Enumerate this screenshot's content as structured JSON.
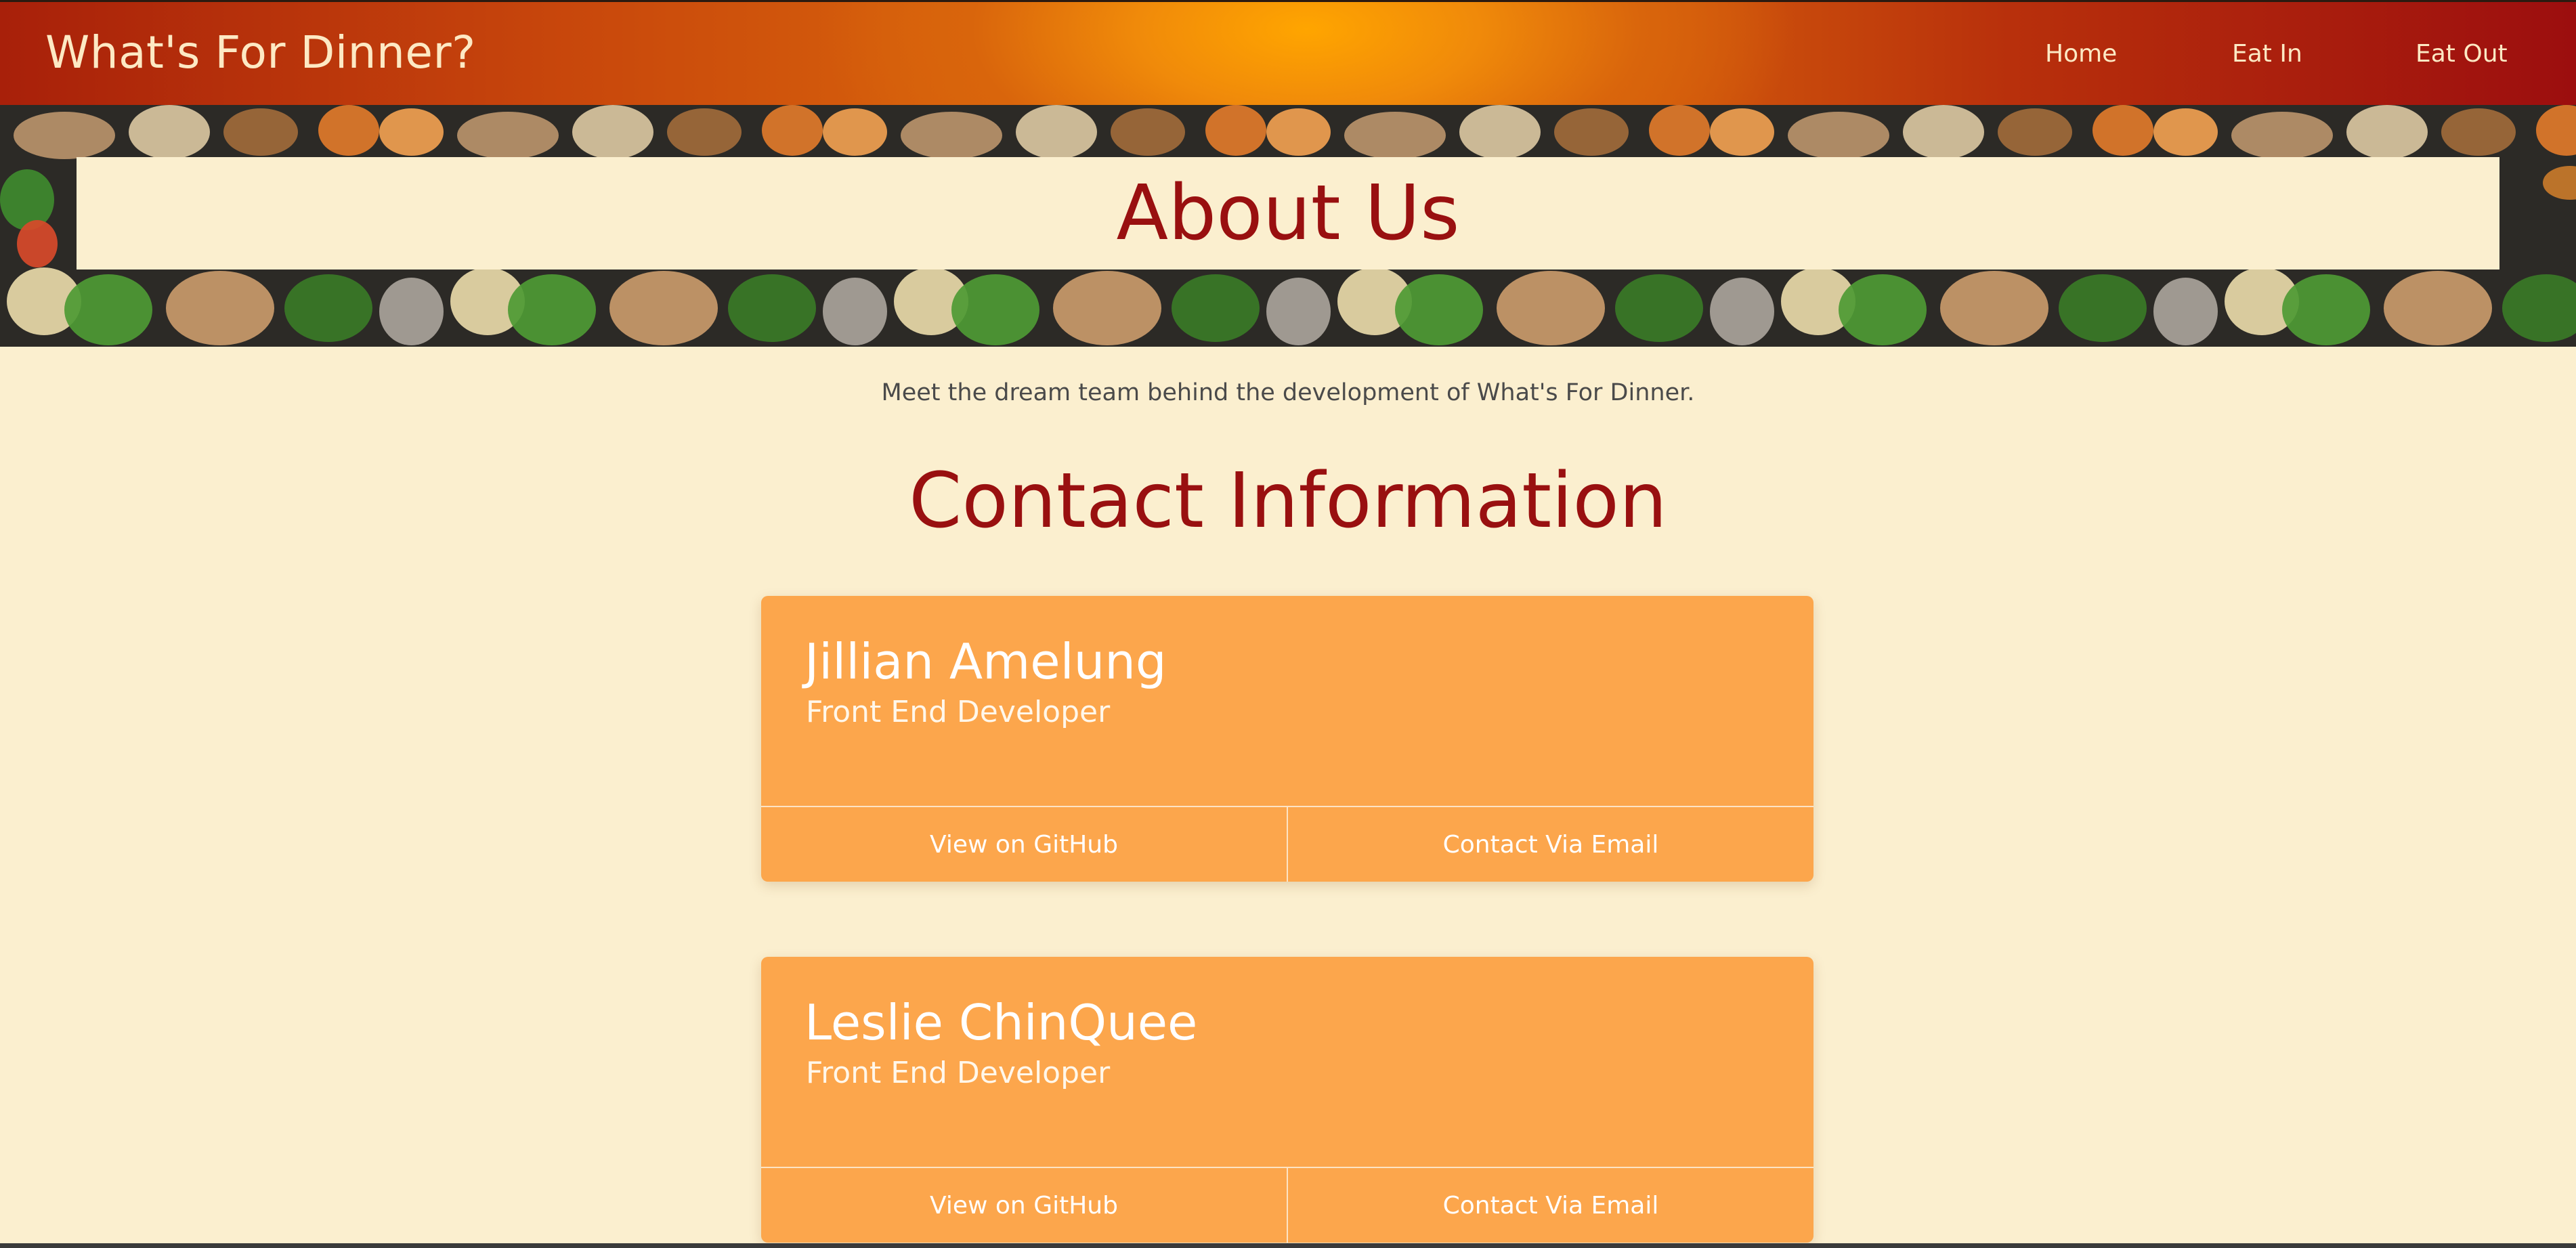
{
  "navbar": {
    "brand": "What's For Dinner?",
    "links": [
      {
        "label": "Home"
      },
      {
        "label": "Eat In"
      },
      {
        "label": "Eat Out"
      }
    ]
  },
  "banner": {
    "title": "About Us"
  },
  "main": {
    "intro": "Meet the dream team behind the development of What's For Dinner.",
    "section_title": "Contact Information",
    "contacts": [
      {
        "name": "Jillian Amelung",
        "role": "Front End Developer",
        "github_label": "View on GitHub",
        "email_label": "Contact Via Email"
      },
      {
        "name": "Leslie ChinQuee",
        "role": "Front End Developer",
        "github_label": "View on GitHub",
        "email_label": "Contact Via Email"
      }
    ]
  },
  "colors": {
    "page_background": "#fbefcf",
    "accent_red": "#991010",
    "card_orange": "#fca64c",
    "nav_orange": "#ffa500"
  }
}
